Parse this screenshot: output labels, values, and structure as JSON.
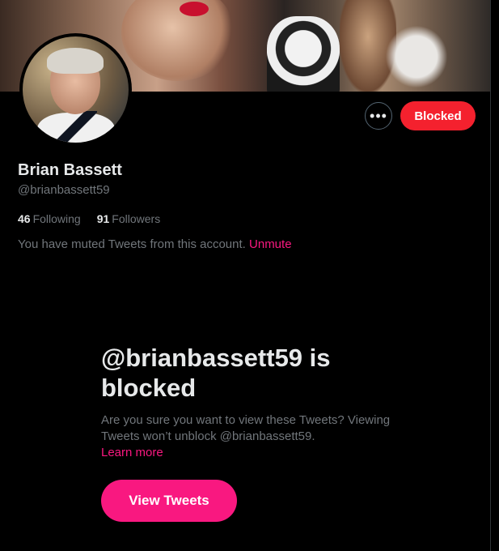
{
  "profile": {
    "name": "Brian Bassett",
    "handle": "@brianbassett59",
    "following_count": "46",
    "following_label": "Following",
    "followers_count": "91",
    "followers_label": "Followers",
    "muted_notice": "You have muted Tweets from this account.",
    "unmute_label": "Unmute"
  },
  "actions": {
    "more_label": "•••",
    "blocked_label": "Blocked"
  },
  "blocked_notice": {
    "title": "@brianbassett59 is blocked",
    "description": "Are you sure you want to view these Tweets? Viewing Tweets won’t unblock @brianbassett59.",
    "learn_more": "Learn more",
    "view_button": "View Tweets"
  },
  "icons": {
    "more": "more-horizontal-icon"
  },
  "colors": {
    "background": "#000000",
    "blocked_red": "#f4212e",
    "accent_pink": "#f91880",
    "secondary_text": "#71767b",
    "primary_text": "#e7e9ea"
  }
}
